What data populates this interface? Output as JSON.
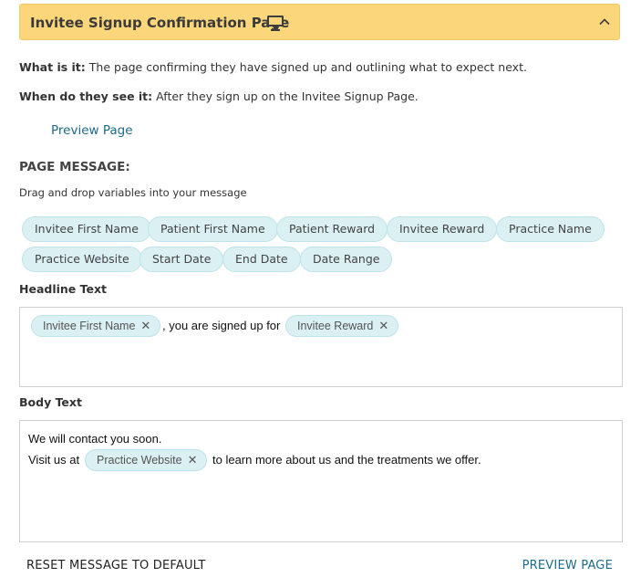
{
  "header": {
    "title": "Invitee Signup Confirmation Page",
    "icon": "monitor-icon",
    "toggle_icon": "chevron-up-icon",
    "accent_color": "#fcd67a"
  },
  "info": {
    "what_label": "What is it:",
    "what_text": "The page confirming they have signed up and outlining what to expect next.",
    "when_label": "When do they see it:",
    "when_text": "After they sign up on the Invitee Signup Page."
  },
  "preview_link": "Preview Page",
  "page_message": {
    "title": "PAGE MESSAGE:",
    "hint": "Drag and drop variables into your message",
    "variables": [
      "Invitee First Name",
      "Patient First Name",
      "Patient Reward",
      "Invitee Reward",
      "Practice Name",
      "Practice Website",
      "Start Date",
      "End Date",
      "Date Range"
    ]
  },
  "headline": {
    "label": "Headline Text",
    "token1": "Invitee First Name",
    "text1": ", you are signed up for",
    "token2": "Invitee Reward"
  },
  "body": {
    "label": "Body Text",
    "line1": "We will contact you soon.",
    "line2_before": "Visit us at",
    "token": "Practice Website",
    "line2_after": "to learn more about us and the treatments we offer."
  },
  "footer": {
    "reset_label": "RESET MESSAGE TO DEFAULT",
    "preview_label": "PREVIEW PAGE"
  },
  "remove_glyph": "✕"
}
